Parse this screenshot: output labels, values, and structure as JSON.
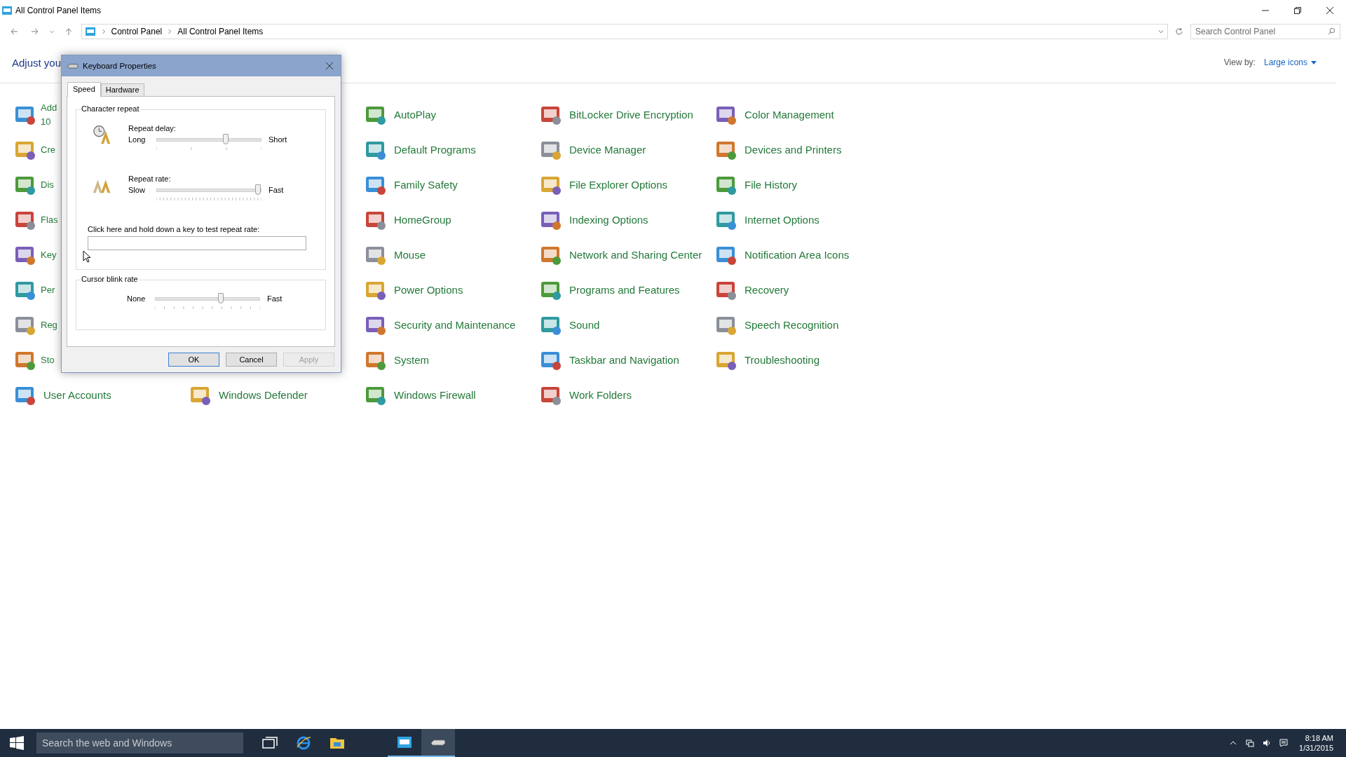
{
  "window": {
    "title": "All Control Panel Items"
  },
  "address_bar": {
    "path": [
      "Control Panel",
      "All Control Panel Items"
    ],
    "search_placeholder": "Search Control Panel"
  },
  "header": {
    "heading": "Adjust you",
    "view_by_label": "View by:",
    "view_by_value": "Large icons"
  },
  "rows": [
    {
      "left": [
        "Add 10"
      ],
      "right": [
        "AutoPlay",
        "BitLocker Drive Encryption",
        "Color Management"
      ]
    },
    {
      "left": [
        "Cre"
      ],
      "right": [
        "Default Programs",
        "Device Manager",
        "Devices and Printers"
      ]
    },
    {
      "left": [
        "Dis"
      ],
      "right": [
        "Family Safety",
        "File Explorer Options",
        "File History"
      ]
    },
    {
      "left": [
        "Flas"
      ],
      "right": [
        "HomeGroup",
        "Indexing Options",
        "Internet Options"
      ]
    },
    {
      "left": [
        "Key"
      ],
      "right": [
        "Mouse",
        "Network and Sharing Center",
        "Notification Area Icons"
      ]
    },
    {
      "left": [
        "Per"
      ],
      "right": [
        "Power Options",
        "Programs and Features",
        "Recovery"
      ]
    },
    {
      "left": [
        "Reg"
      ],
      "right": [
        "Security and Maintenance",
        "Sound",
        "Speech Recognition"
      ]
    },
    {
      "left": [
        "Sto"
      ],
      "right": [
        "System",
        "Taskbar and Navigation",
        "Troubleshooting"
      ]
    },
    {
      "left": [
        "User Accounts",
        "Windows Defender"
      ],
      "right": [
        "Windows Firewall",
        "Work Folders"
      ]
    }
  ],
  "dialog": {
    "title": "Keyboard Properties",
    "tabs": [
      {
        "label": "Speed",
        "selected": true
      },
      {
        "label": "Hardware",
        "selected": false
      }
    ],
    "character_repeat": {
      "title": "Character repeat",
      "sliders": [
        {
          "label": "Repeat delay:",
          "min_label": "Long",
          "max_label": "Short",
          "level": 0.66
        },
        {
          "label": "Repeat rate:",
          "min_label": "Slow",
          "max_label": "Fast",
          "level": 0.97
        }
      ],
      "test_prompt": "Click here and hold down a key to test repeat rate:"
    },
    "cursor_blink": {
      "title": "Cursor blink rate",
      "min_label": "None",
      "max_label": "Fast",
      "level": 0.63
    },
    "buttons": [
      {
        "label": "OK",
        "default": true,
        "disabled": false
      },
      {
        "label": "Cancel",
        "default": false,
        "disabled": false
      },
      {
        "label": "Apply",
        "default": false,
        "disabled": true
      }
    ]
  },
  "taskbar": {
    "search_placeholder": "Search the web and Windows",
    "apps": [
      {
        "kind": "task-view",
        "running": false,
        "selected": false
      },
      {
        "kind": "browser",
        "running": false,
        "selected": false
      },
      {
        "kind": "folder",
        "running": false,
        "selected": false
      },
      {
        "kind": "control-panel",
        "running": true,
        "selected": false
      },
      {
        "kind": "keyboard",
        "running": true,
        "selected": true
      }
    ],
    "time": "8:18 AM",
    "date": "1/31/2015"
  }
}
